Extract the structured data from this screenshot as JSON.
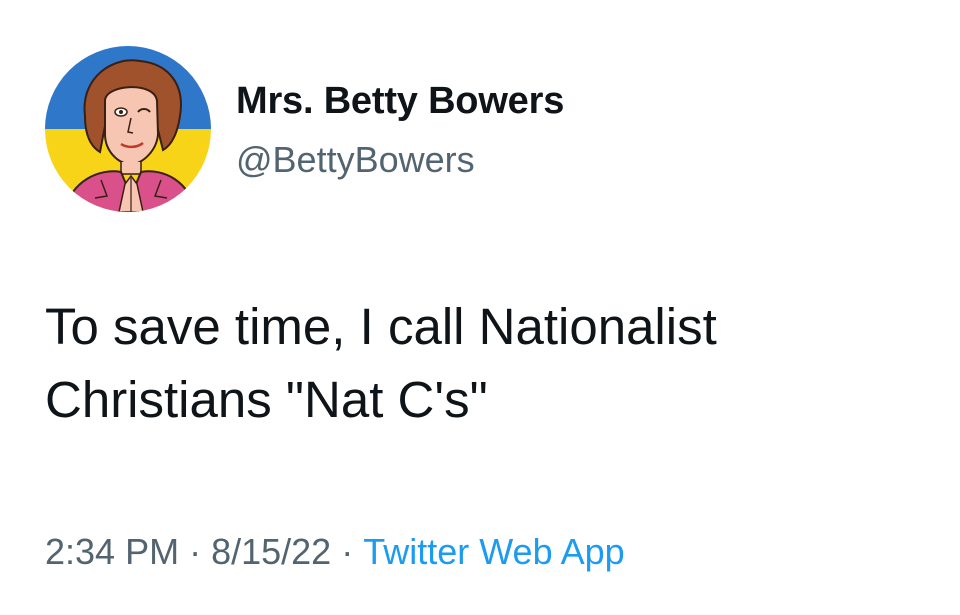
{
  "user": {
    "display_name": "Mrs. Betty Bowers",
    "handle": "@BettyBowers",
    "avatar": "cartoon-woman-avatar-on-blue-yellow-flag"
  },
  "tweet": {
    "line1": "To save time, I call Nationalist",
    "line2": "Christians \"Nat C's\""
  },
  "meta": {
    "time": "2:34 PM",
    "separator": "·",
    "date": "8/15/22",
    "source": "Twitter Web App"
  },
  "colors": {
    "text": "#0f1419",
    "secondary": "#536471",
    "link": "#1d9bf0",
    "flag_blue": "#2f77c8",
    "flag_yellow": "#f7d417"
  }
}
